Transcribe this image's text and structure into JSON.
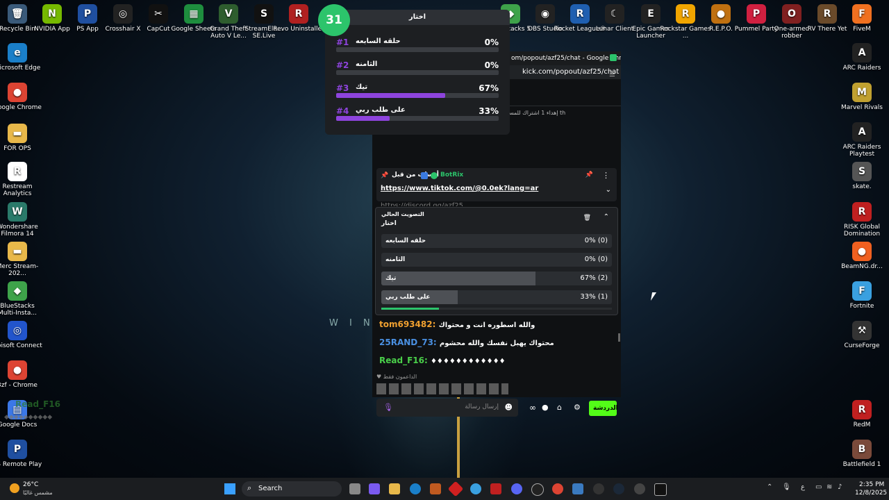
{
  "desktop": {
    "top_icons": [
      {
        "label": "Recycle Bin",
        "glyph": "🗑",
        "color": "#3a5a7a"
      },
      {
        "label": "NVIDIA App",
        "glyph": "N",
        "color": "#76b900"
      },
      {
        "label": "PS App",
        "glyph": "P",
        "color": "#1f4fa0"
      },
      {
        "label": "Crosshair X",
        "glyph": "◎",
        "color": "#222"
      },
      {
        "label": "CapCut",
        "glyph": "✂",
        "color": "#111"
      },
      {
        "label": "Google Sheets",
        "glyph": "▦",
        "color": "#1e8e3e"
      },
      {
        "label": "Grand Theft Auto V Le...",
        "glyph": "V",
        "color": "#2e5d2e"
      },
      {
        "label": "StreamEle... SE.Live",
        "glyph": "S",
        "color": "#111"
      },
      {
        "label": "Revo Uninstaller",
        "glyph": "R",
        "color": "#b02020"
      }
    ],
    "right_top_icons": [
      {
        "label": "BlueStacks 5",
        "glyph": "◆",
        "color": "#3ea34a"
      },
      {
        "label": "OBS Studio",
        "glyph": "◉",
        "color": "#222"
      },
      {
        "label": "Rocket League®",
        "glyph": "R",
        "color": "#1f5fb0"
      },
      {
        "label": "Lunar Client",
        "glyph": "☾",
        "color": "#222"
      },
      {
        "label": "Epic Games Launcher",
        "glyph": "E",
        "color": "#222"
      },
      {
        "label": "Rockstar Games ...",
        "glyph": "R",
        "color": "#f0a500"
      },
      {
        "label": "R.E.P.O.",
        "glyph": "●",
        "color": "#c07010"
      },
      {
        "label": "Pummel Party",
        "glyph": "P",
        "color": "#d02040"
      },
      {
        "label": "One-armed robber",
        "glyph": "O",
        "color": "#802020"
      },
      {
        "label": "RV There Yet",
        "glyph": "R",
        "color": "#6a4a2a"
      },
      {
        "label": "FiveM",
        "glyph": "F",
        "color": "#f07020"
      }
    ],
    "left_icons": [
      {
        "label": "Microsoft Edge",
        "glyph": "e",
        "color": "#1a7fc9"
      },
      {
        "label": "Google Chrome",
        "glyph": "●",
        "color": "#dd4433"
      },
      {
        "label": "FOR OPS",
        "glyph": "▬",
        "color": "#e8b84a"
      },
      {
        "label": "Restream Analytics",
        "glyph": "R",
        "color": "#fff"
      },
      {
        "label": "Wondershare Filmora 14",
        "glyph": "W",
        "color": "#2a7a6a"
      },
      {
        "label": "Merc Stream-202...",
        "glyph": "▬",
        "color": "#e8b84a"
      },
      {
        "label": "BlueStacks Multi-Insta...",
        "glyph": "◆",
        "color": "#3ea34a"
      },
      {
        "label": "Ubisoft Connect",
        "glyph": "◎",
        "color": "#2255cc"
      },
      {
        "label": "3zf - Chrome",
        "glyph": "●",
        "color": "#dd4433"
      },
      {
        "label": "Google Docs",
        "glyph": "▤",
        "color": "#3b78e7"
      },
      {
        "label": "PS Remote Play",
        "glyph": "P",
        "color": "#1f4fa0"
      }
    ],
    "right_icons": [
      {
        "label": "ARC Raiders",
        "glyph": "A",
        "color": "#222"
      },
      {
        "label": "Marvel Rivals",
        "glyph": "M",
        "color": "#c0a030"
      },
      {
        "label": "ARC Raiders Playtest",
        "glyph": "A",
        "color": "#222"
      },
      {
        "label": "skate.",
        "glyph": "S",
        "color": "#555"
      },
      {
        "label": "RISK Global Domination",
        "glyph": "R",
        "color": "#c02020"
      },
      {
        "label": "BeamNG.dr...",
        "glyph": "●",
        "color": "#f06020"
      },
      {
        "label": "Fortnite",
        "glyph": "F",
        "color": "#3aa0e0"
      },
      {
        "label": "CurseForge",
        "glyph": "⚒",
        "color": "#333"
      },
      {
        "label": "RedM",
        "glyph": "R",
        "color": "#c02020"
      },
      {
        "label": "Battlefield 1",
        "glyph": "B",
        "color": "#7a4a3a"
      }
    ],
    "overlay_name": "Read_F16",
    "overlay_sub": "◆◆◆◆◆◆◆◆◆◆"
  },
  "poll_widget": {
    "timer": "31",
    "title": "اختار",
    "options": [
      {
        "num": "#1",
        "label": "حلقه السابعه",
        "pct": "0%",
        "value": 0
      },
      {
        "num": "#2",
        "label": "الثامنه",
        "pct": "0%",
        "value": 0
      },
      {
        "num": "#3",
        "label": "تيك",
        "pct": "67%",
        "value": 67
      },
      {
        "num": "#4",
        "label": "على طلب ربي",
        "pct": "33%",
        "value": 33
      }
    ]
  },
  "chrome": {
    "title": "om/popout/azf25/chat - Google Chrome",
    "url": "kick.com/popout/azf25/chat",
    "notice": "إهداء 1 اشتراك للمستخدم th",
    "pinned": {
      "sent_by": "أرسلت من قبل",
      "user": "BotRix",
      "link": "https://www.tiktok.com/@0.0ek?lang=ar",
      "hidden_link": "https://discord.gg/azf25"
    },
    "poll": {
      "header": "التصويت الحالي",
      "title": "اختار",
      "progress": 0.25,
      "options": [
        {
          "label": "حلقه السابعه",
          "pct": "0% (0)",
          "value": 0
        },
        {
          "label": "الثامنه",
          "pct": "0% (0)",
          "value": 0
        },
        {
          "label": "تيك",
          "pct": "67% (2)",
          "value": 67
        },
        {
          "label": "على طلب ربي",
          "pct": "33% (1)",
          "value": 33
        }
      ]
    },
    "messages": [
      {
        "user": "tom693482:",
        "text": "والله اسطوره انت و محتواك",
        "color": "#f0a030"
      },
      {
        "user": "25RAND_73:",
        "text": "محتواك يهبل نفسك والله محشوم",
        "color": "#4a90e2"
      },
      {
        "user": "Read_F16:",
        "text": "♦♦♦♦♦♦♦♦♦♦♦♦",
        "color": "#4ad04a"
      }
    ],
    "followers_label": "الداعمون فقط",
    "input_placeholder": "إرسال رسالة",
    "chat_button": "الدردشة"
  },
  "taskbar": {
    "weather_temp": "26°C",
    "weather_desc": "مشمس غالبًا",
    "search": "Search",
    "lang": "ع",
    "time": "2:35 PM",
    "date": "12/8/2025"
  }
}
